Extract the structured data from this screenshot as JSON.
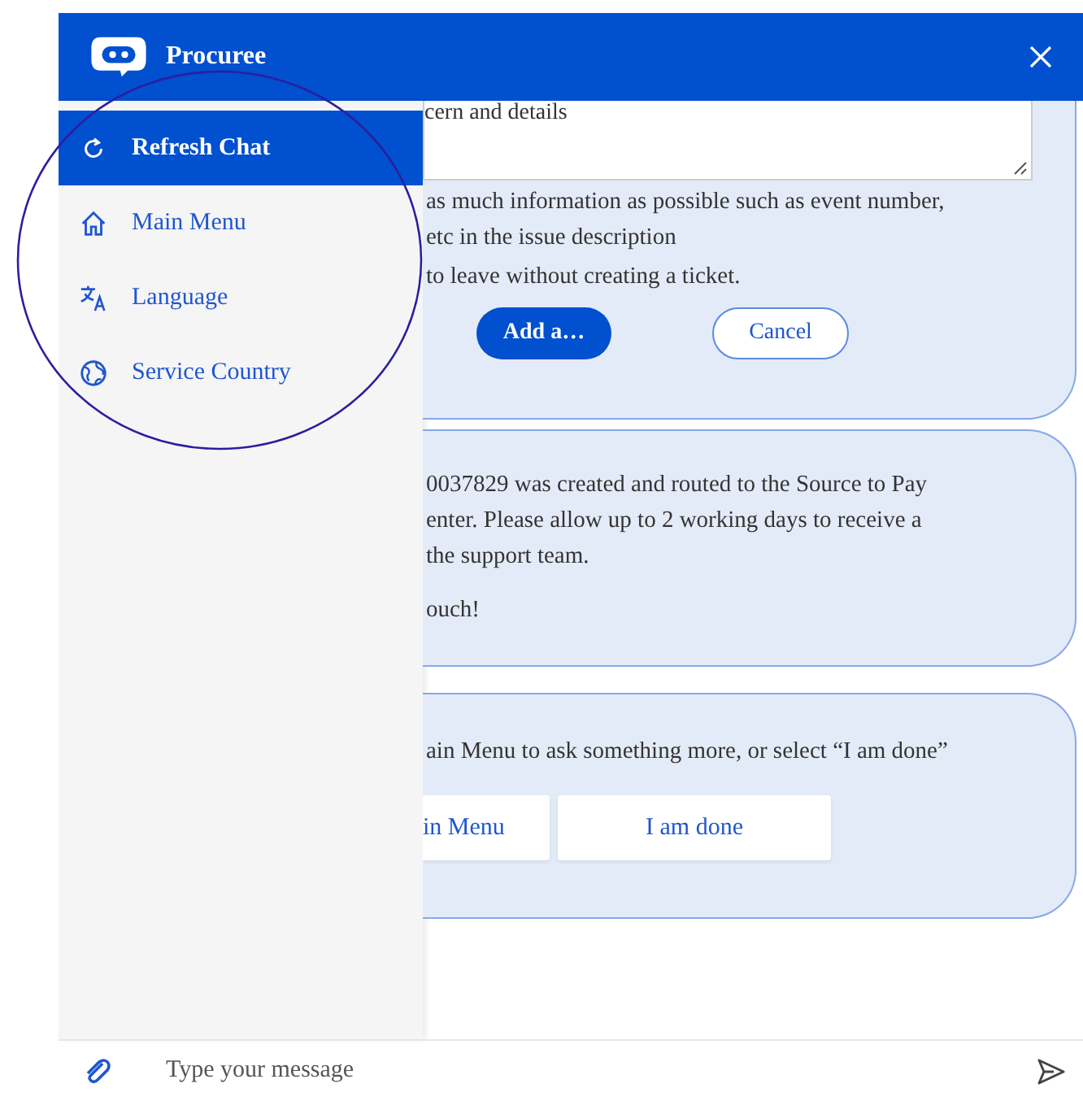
{
  "header": {
    "title": "Procuree"
  },
  "menu": {
    "items": [
      {
        "label": "Refresh Chat",
        "kind": "refresh",
        "selected": true
      },
      {
        "label": "Main Menu",
        "kind": "home",
        "selected": false
      },
      {
        "label": "Language",
        "kind": "translate",
        "selected": false
      },
      {
        "label": "Service Country",
        "kind": "globe",
        "selected": false
      }
    ]
  },
  "messages": [
    {
      "kind": "form",
      "field_value": "cern and details",
      "lines": [
        "as much information as possible such as event number,",
        "etc in the issue description",
        "to leave without creating a ticket."
      ],
      "buttons": [
        {
          "label": "Add a…",
          "kind": "primary"
        },
        {
          "label": "Cancel",
          "kind": "outline"
        }
      ]
    },
    {
      "kind": "text",
      "lines": [
        "0037829 was created and routed to the Source to Pay",
        "enter. Please allow up to 2 working days to receive a",
        "the support team.",
        "ouch!"
      ]
    },
    {
      "kind": "choices",
      "lines": [
        "ain Menu to ask something more, or select “I am done”"
      ],
      "buttons": [
        {
          "label": "in Menu",
          "kind": "plain"
        },
        {
          "label": "I am done",
          "kind": "plain"
        }
      ]
    }
  ],
  "composer": {
    "placeholder": "Type your message"
  }
}
